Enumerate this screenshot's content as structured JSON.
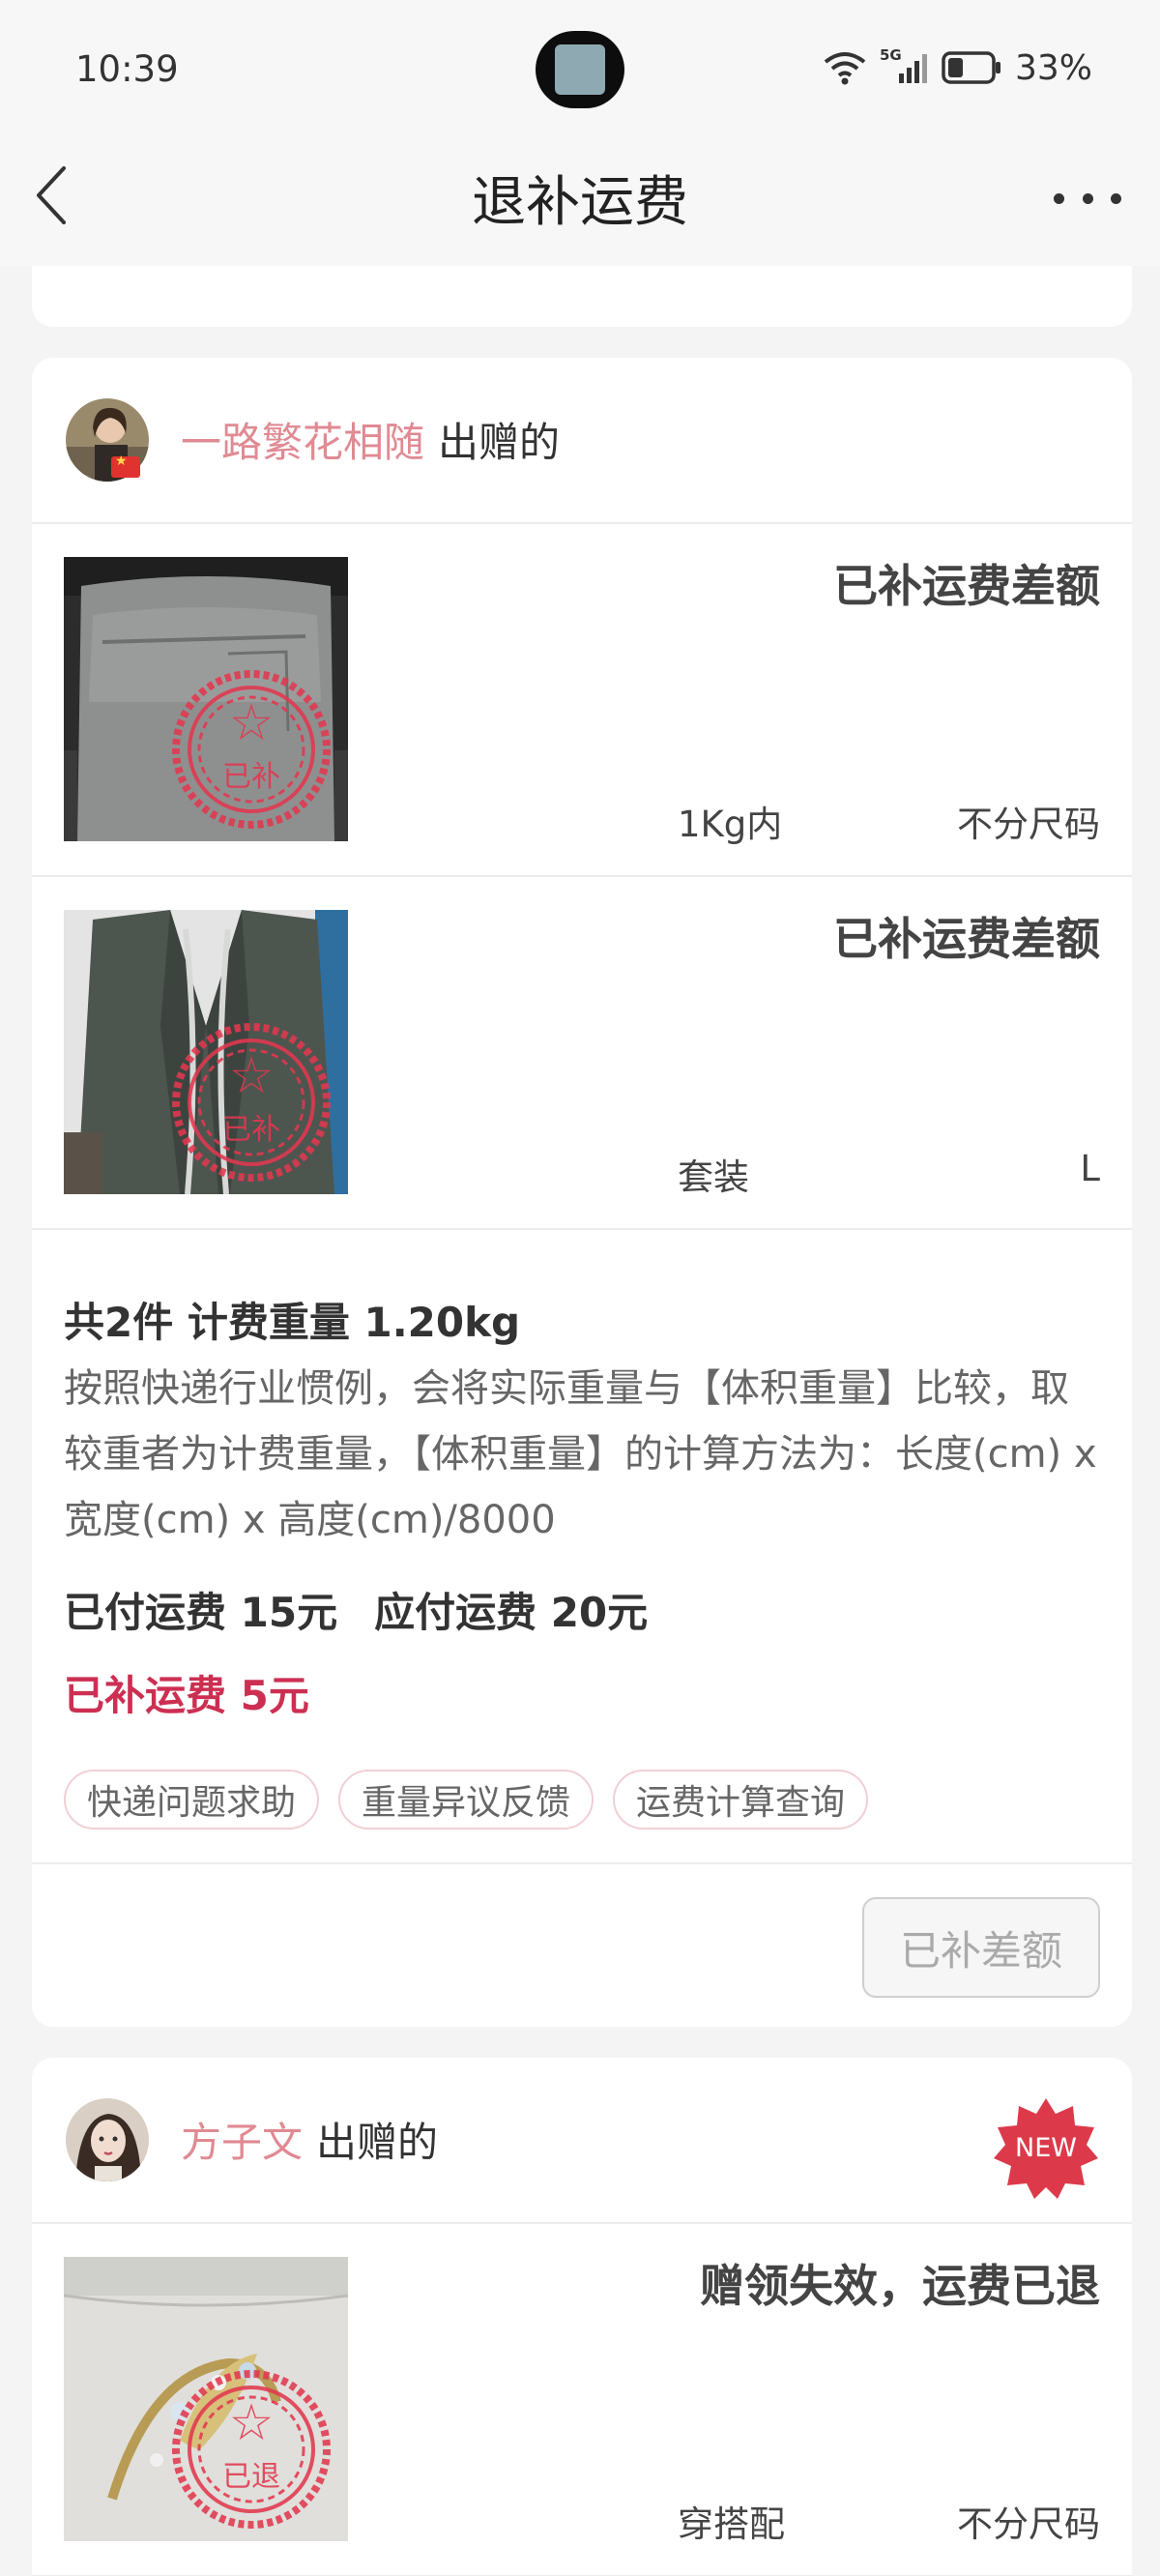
{
  "status_bar": {
    "time": "10:39",
    "network": "5G",
    "battery": "33%"
  },
  "header": {
    "title": "退补运费",
    "back_icon": "chevron-left-icon",
    "more_icon": "more-horizontal-icon"
  },
  "orders": [
    {
      "giver_name": "一路繁花相随",
      "giver_suffix": "出赠的",
      "items": [
        {
          "status": "已补运费差额",
          "meta_left": "1Kg内",
          "meta_right": "不分尺码",
          "stamp_text": "已补"
        },
        {
          "status": "已补运费差额",
          "meta_left": "套装",
          "meta_right": "L",
          "stamp_text": "已补"
        }
      ],
      "summary": {
        "title": "共2件 计费重量 1.20kg",
        "description": "按照快递行业惯例，会将实际重量与【体积重量】比较，取较重者为计费重量，【体积重量】的计算方法为：长度(cm) x 宽度(cm) x 高度(cm)/8000",
        "paid": "已付运费 15元",
        "due": "应付运费 20元",
        "refund": "已补运费 5元"
      },
      "chips": [
        "快递问题求助",
        "重量异议反馈",
        "运费计算查询"
      ],
      "action_label": "已补差额"
    },
    {
      "giver_name": "方子文",
      "giver_suffix": "出赠的",
      "badge": "NEW",
      "items": [
        {
          "status": "赠领失效，运费已退",
          "meta_left": "穿搭配",
          "meta_right": "不分尺码",
          "stamp_text": "已退"
        }
      ]
    }
  ],
  "colors": {
    "accent": "#cc2f52",
    "giver_name": "#e08a93",
    "stamp": "#e2384f"
  }
}
